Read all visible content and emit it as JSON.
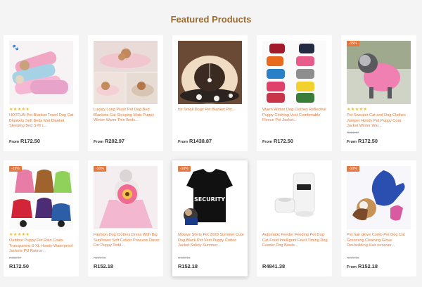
{
  "section": {
    "title": "Featured Products"
  },
  "products": [
    {
      "stars": "★★★★★",
      "name": "HOTFUN Pet Blanket Towel Dog Cat Blankets Soft Beds Mat Blanket Sleeping Bed S M L...",
      "prefix": "From",
      "price": "R172.50"
    },
    {
      "stars": "",
      "name": "Luxury Long Plush Pet Dog Bed Blankets Cat Sleeping Mats Puppy Winter Warm Thin Beds...",
      "prefix": "From",
      "price": "R202.97"
    },
    {
      "stars": "",
      "name": "for Small Dogs Pet Blanket Pet...",
      "prefix": "From",
      "price": "R1438.87"
    },
    {
      "stars": "",
      "name": "Warm Winter Dog Clothes Reflective Puppy Clothing Vest Comfortable Fleece Pet Jacket...",
      "prefix": "From",
      "price": "R172.50"
    },
    {
      "badge": "-15%",
      "stars": "★★★★★",
      "name": "Pet Sweater Cat and Dog Clothes Jumper Hoody Pet Puppy Coat Jacket Winter War...",
      "old_price": "R202.97",
      "prefix": "From",
      "price": "R172.50"
    },
    {
      "badge": "-15%",
      "stars": "★★★★★",
      "name": "Outdoor Puppy Pet Rain Coats Transparent S-XL Hoody Waterproof Jackets PU Rainco...",
      "old_price": "R202.97",
      "prefix": "",
      "price": "R172.50"
    },
    {
      "badge": "-10%",
      "stars": "",
      "name": "Fashion Dog Clothes Dress With Big Sunflower Soft Cotton Princess Dress For Puppy Tedd...",
      "old_price": "R169.13",
      "prefix": "",
      "price": "R152.18"
    },
    {
      "badge": "-10%",
      "stars": "",
      "name": "Molave Shirts Pet 2020 Summer Cute Dog Black Pet Vest Puppy Cotton Jacket Safety Summer...",
      "old_price": "R169.13",
      "prefix": "",
      "price": "R152.18"
    },
    {
      "stars": "",
      "name": "Automatic Feeder Feeding Pet Dog Cat Food Intelligent Feed Timing Dog Feeder Dog Bowls...",
      "prefix": "",
      "price": "R4841.38"
    },
    {
      "badge": "-10%",
      "stars": "",
      "name": "Pet hair glove Comb Pet Dog Cat Grooming Cleaning Glove Deshedding Hair remover...",
      "old_price": "R169.13",
      "prefix": "From",
      "price": "R152.18"
    }
  ],
  "colors": {
    "title": "#9c6a2c",
    "product_name": "#e07a3a",
    "badge": "#e8763a",
    "stars": "#e9b93c"
  }
}
